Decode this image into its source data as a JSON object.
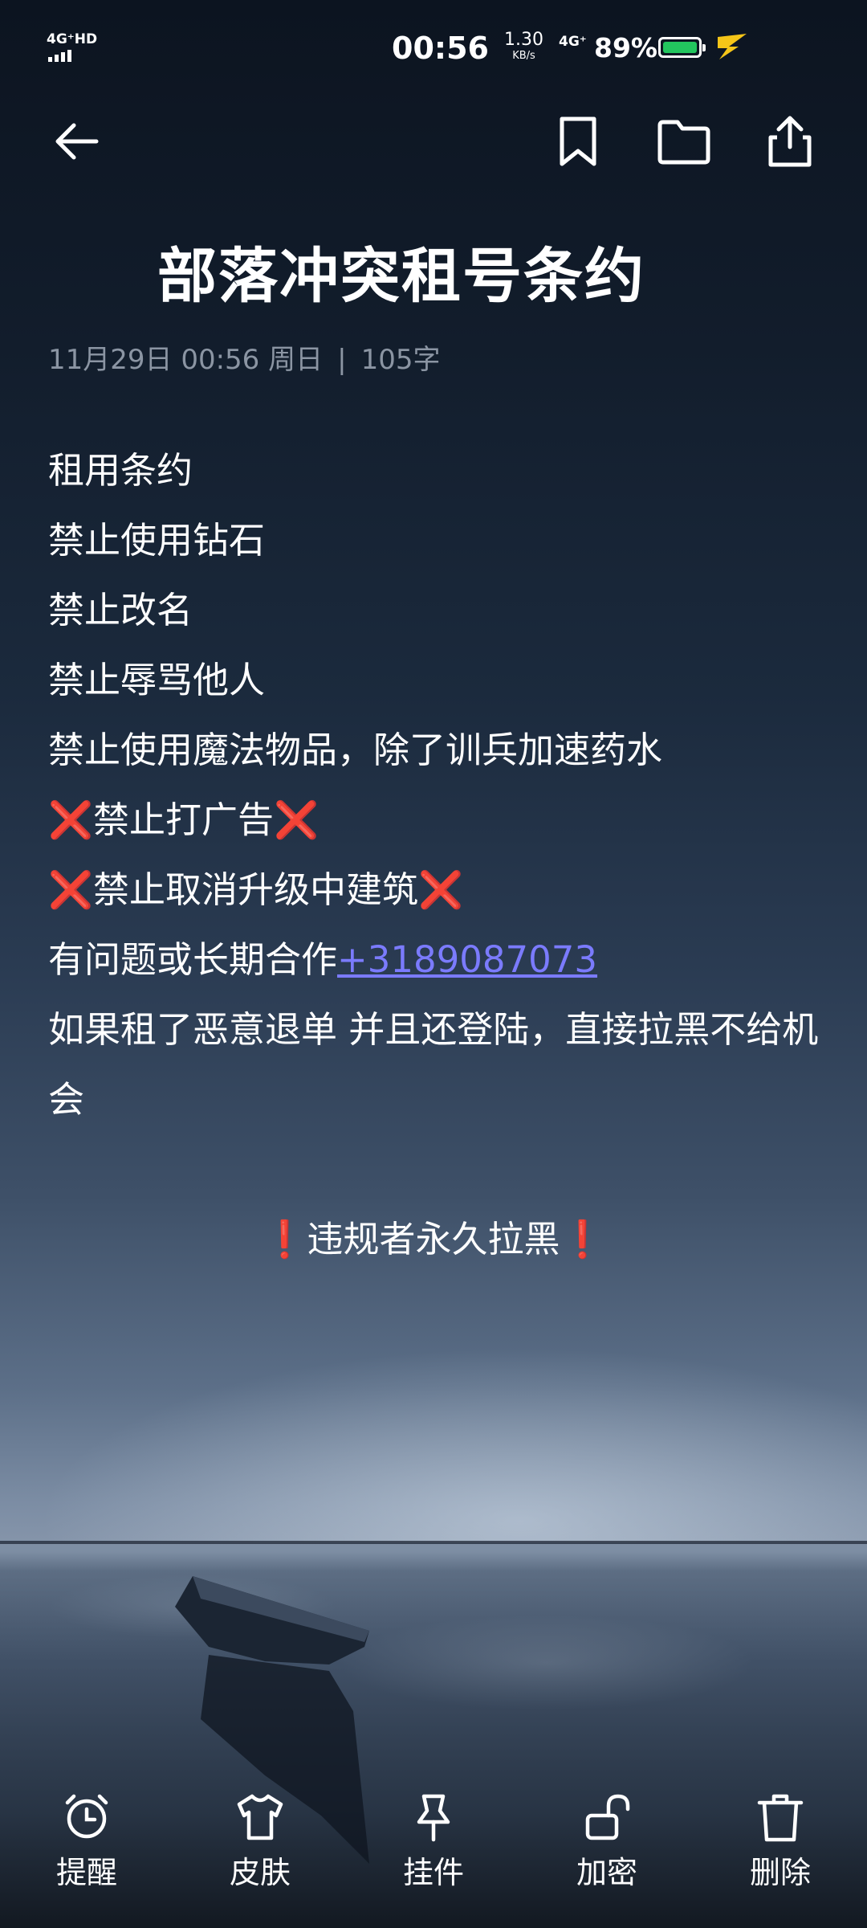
{
  "status_bar": {
    "network_left": "4G⁺HD",
    "time": "00:56",
    "speed_value": "1.30",
    "speed_unit": "KB/s",
    "network_right": "4G⁺",
    "battery": "89%",
    "battery_color": "#22c55e"
  },
  "toolbar": {
    "icons": [
      "back-arrow-icon",
      "bookmark-icon",
      "folder-icon",
      "share-icon"
    ]
  },
  "note": {
    "title": "部落冲突租号条约",
    "date": "11月29日 00:56 周日",
    "separator": "|",
    "word_count": "105字",
    "lines": [
      "租用条约",
      "禁止使用钻石",
      "禁止改名",
      "禁止辱骂他人",
      "禁止使用魔法物品，除了训兵加速药水"
    ],
    "cross_line_1": "禁止打广告",
    "cross_line_2": "禁止取消升级中建筑",
    "cross_mark": "❌",
    "contact_text": "有问题或长期合作",
    "contact_phone": "+3189087073",
    "refund_line": "如果租了恶意退单 并且还登陆，直接拉黑不给机会",
    "warning_text": "违规者永久拉黑",
    "warning_mark": "❗"
  },
  "bottom_bar": {
    "items": [
      "提醒",
      "皮肤",
      "挂件",
      "加密",
      "删除"
    ]
  },
  "colors": {
    "accent_link": "#7b7bff",
    "cross_red": "#e02424",
    "meta_gray": "#8b95a3"
  }
}
